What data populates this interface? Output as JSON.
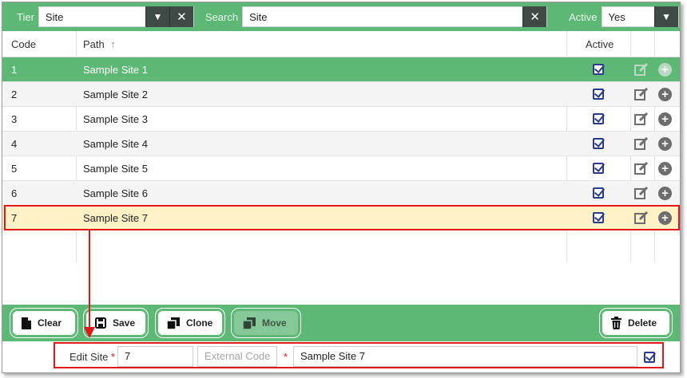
{
  "filters": {
    "tier_label": "Tier",
    "tier_value": "Site",
    "search_label": "Search",
    "search_value": "Site",
    "active_label": "Active",
    "active_value": "Yes"
  },
  "table": {
    "columns": {
      "code": "Code",
      "path": "Path",
      "sort_icon": "↑",
      "active": "Active"
    },
    "rows": [
      {
        "code": "1",
        "path": "Sample Site 1"
      },
      {
        "code": "2",
        "path": "Sample Site 2"
      },
      {
        "code": "3",
        "path": "Sample Site 3"
      },
      {
        "code": "4",
        "path": "Sample Site 4"
      },
      {
        "code": "5",
        "path": "Sample Site 5"
      },
      {
        "code": "6",
        "path": "Sample Site 6"
      },
      {
        "code": "7",
        "path": "Sample Site 7"
      }
    ]
  },
  "buttons": {
    "clear": "Clear",
    "save": "Save",
    "clone": "Clone",
    "move": "Move",
    "delete": "Delete"
  },
  "edit": {
    "label": "Edit Site",
    "required_mark": "*",
    "code_value": "7",
    "external_code_placeholder": "External Code",
    "name_value": "Sample Site 7"
  },
  "colors": {
    "accent_green": "#5cb874",
    "highlight_yellow": "#fff1c6",
    "annotation_red": "#e01818",
    "checkbox_navy": "#2b3a8a"
  }
}
